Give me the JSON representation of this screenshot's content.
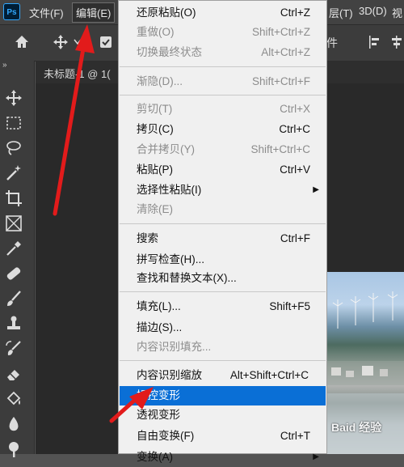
{
  "app": {
    "logo": "Ps"
  },
  "menubar": {
    "file": "文件(F)",
    "edit": "编辑(E)",
    "layer_partial": "层(T)",
    "threed": "3D(D)",
    "view_partial": "视"
  },
  "options_bar": {
    "partial_text": "件"
  },
  "document_tab": {
    "title_partial": "未标题-1 @ 1("
  },
  "edit_menu": {
    "undo": {
      "label": "还原粘贴(O)",
      "shortcut": "Ctrl+Z"
    },
    "redo": {
      "label": "重做(O)",
      "shortcut": "Shift+Ctrl+Z"
    },
    "toggle_last_state": {
      "label": "切换最终状态",
      "shortcut": "Alt+Ctrl+Z"
    },
    "fade": {
      "label": "渐隐(D)...",
      "shortcut": "Shift+Ctrl+F"
    },
    "cut": {
      "label": "剪切(T)",
      "shortcut": "Ctrl+X"
    },
    "copy": {
      "label": "拷贝(C)",
      "shortcut": "Ctrl+C"
    },
    "copy_merged": {
      "label": "合并拷贝(Y)",
      "shortcut": "Shift+Ctrl+C"
    },
    "paste": {
      "label": "粘贴(P)",
      "shortcut": "Ctrl+V"
    },
    "paste_special": {
      "label": "选择性粘贴(I)"
    },
    "clear": {
      "label": "清除(E)"
    },
    "search": {
      "label": "搜索",
      "shortcut": "Ctrl+F"
    },
    "spell_check": {
      "label": "拼写检查(H)..."
    },
    "find_replace": {
      "label": "查找和替换文本(X)..."
    },
    "fill": {
      "label": "填充(L)...",
      "shortcut": "Shift+F5"
    },
    "stroke": {
      "label": "描边(S)..."
    },
    "content_aware_fill": {
      "label": "内容识别填充..."
    },
    "content_aware_scale": {
      "label": "内容识别缩放",
      "shortcut": "Alt+Shift+Ctrl+C"
    },
    "puppet_warp": {
      "label": "操控变形"
    },
    "perspective_warp": {
      "label": "透视变形"
    },
    "free_transform": {
      "label": "自由变换(F)",
      "shortcut": "Ctrl+T"
    },
    "transform_partial": {
      "label": "变换(A)"
    }
  },
  "watermark": "Baid 经验",
  "colors": {
    "menu_bg": "#f0f0f0",
    "highlight": "#0a6fd6",
    "disabled_text": "#8c8c8c",
    "arrow": "#e21b1b",
    "app_dark": "#3c3c3c"
  }
}
